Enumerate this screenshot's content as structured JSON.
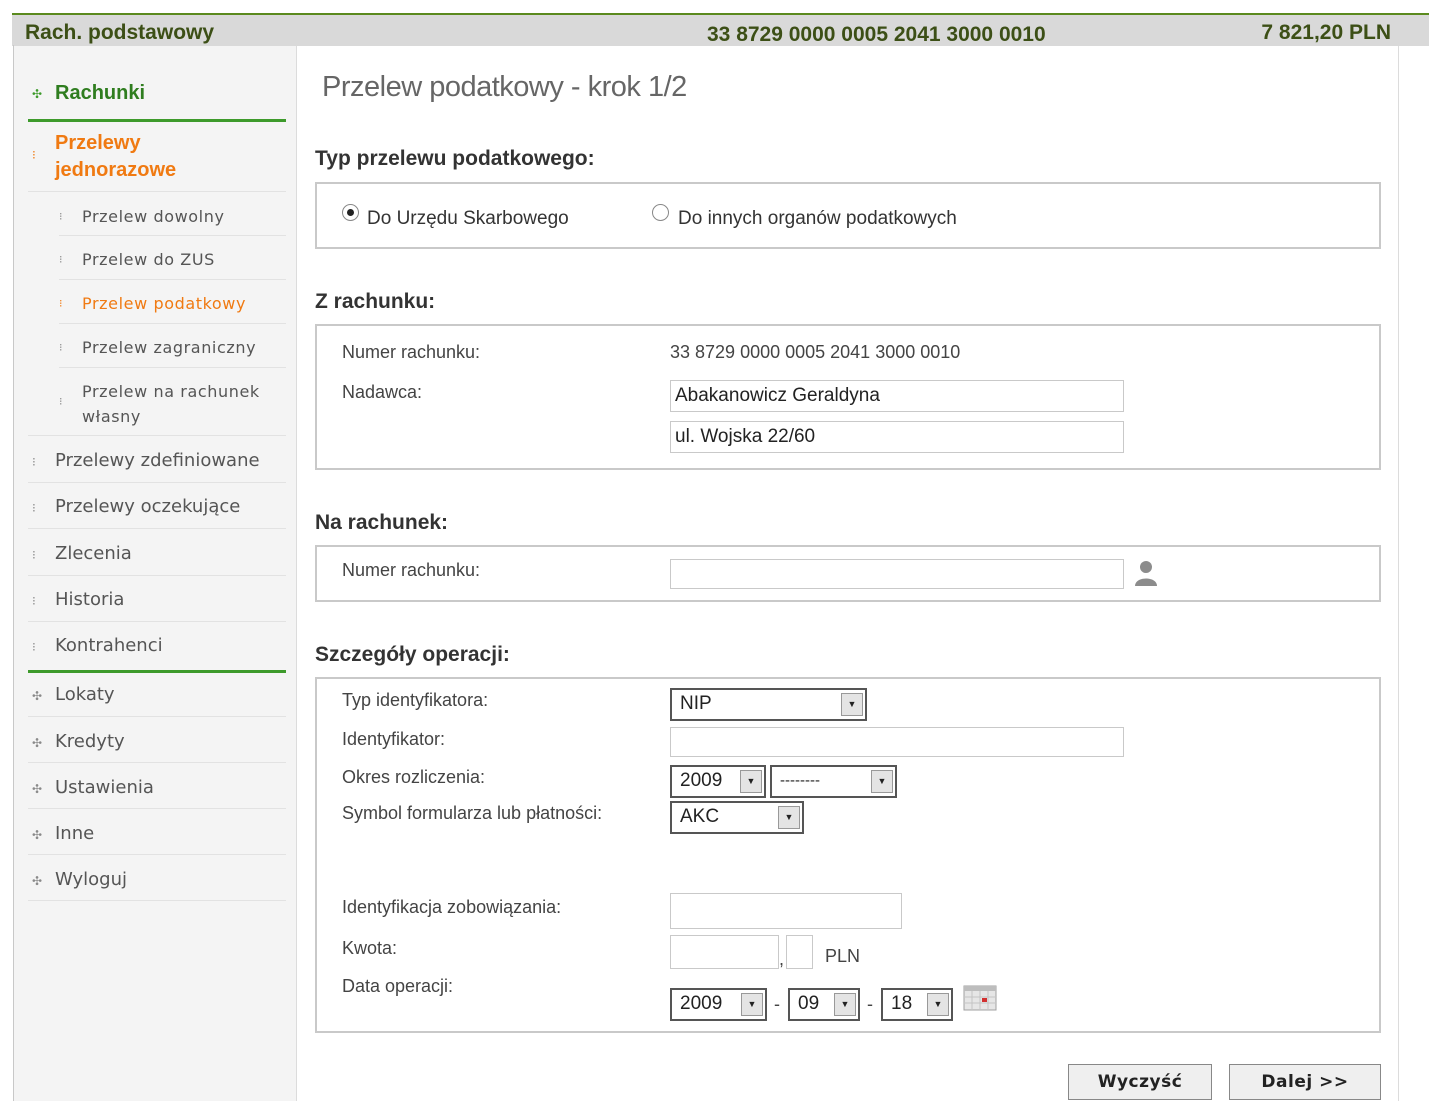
{
  "header": {
    "account_name": "Rach. podstawowy",
    "account_number": "33 8729 0000 0005 2041 3000 0010",
    "balance": "7 821,20 PLN"
  },
  "sidebar": {
    "rachunki": "Rachunki",
    "przelewy_jednorazowe": "Przelewy jednorazowe",
    "sub": [
      "Przelew dowolny",
      "Przelew do ZUS",
      "Przelew podatkowy",
      "Przelew zagraniczny",
      "Przelew na rachunek własny"
    ],
    "items": [
      "Przelewy zdefiniowane",
      "Przelewy oczekujące",
      "Zlecenia",
      "Historia",
      "Kontrahenci"
    ],
    "bottom": [
      "Lokaty",
      "Kredyty",
      "Ustawienia",
      "Inne",
      "Wyloguj"
    ]
  },
  "page_title": "Przelew podatkowy - krok 1/2",
  "type_section": {
    "title": "Typ przelewu podatkowego:",
    "option1": "Do Urzędu Skarbowego",
    "option2": "Do innych organów podatkowych",
    "selected": "option1"
  },
  "from_section": {
    "title": "Z rachunku:",
    "account_label": "Numer rachunku:",
    "account_value": "33 8729 0000 0005 2041 3000 0010",
    "sender_label": "Nadawca:",
    "sender_name": "Abakanowicz Geraldyna",
    "sender_address": "ul. Wojska 22/60"
  },
  "to_section": {
    "title": "Na rachunek:",
    "account_label": "Numer rachunku:",
    "account_value": ""
  },
  "details": {
    "title": "Szczegóły operacji:",
    "id_type_label": "Typ identyfikatora:",
    "id_type_value": "NIP",
    "identifier_label": "Identyfikator:",
    "identifier_value": "",
    "period_label": "Okres rozliczenia:",
    "period_year": "2009",
    "period_sub": "--------",
    "symbol_label": "Symbol formularza lub płatności:",
    "symbol_value": "AKC",
    "obligation_label": "Identyfikacja zobowiązania:",
    "obligation_value": "",
    "amount_label": "Kwota:",
    "amount_int": "",
    "amount_sep": ",",
    "amount_dec": "",
    "currency": "PLN",
    "date_label": "Data operacji:",
    "date_year": "2009",
    "date_month": "09",
    "date_day": "18",
    "date_sep": "-"
  },
  "buttons": {
    "clear": "Wyczyść",
    "next": "Dalej >>"
  }
}
